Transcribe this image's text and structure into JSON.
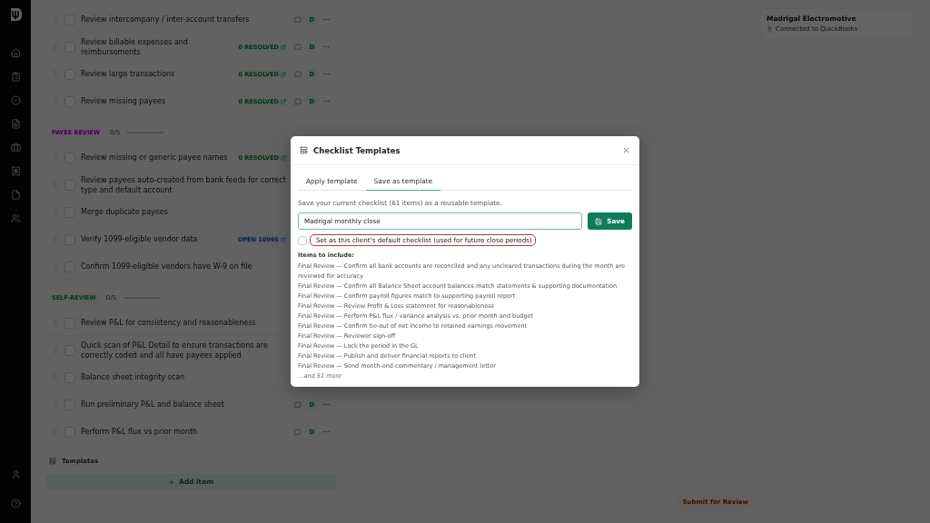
{
  "sections": [
    {
      "items": [
        {
          "title": "Review intercompany / inter-account transfers",
          "checked": false,
          "actions": {
            "avatar": "D"
          }
        },
        {
          "title": "Review billable expenses and reimbursements",
          "checked": false,
          "badge": {
            "text": "0 RESOLVED",
            "kind": "resolved"
          },
          "actions": {
            "avatar": "D"
          }
        },
        {
          "title": "Review large transactions",
          "checked": false,
          "badge": {
            "text": "0 RESOLVED",
            "kind": "resolved"
          },
          "actions": {
            "avatar": "D"
          }
        },
        {
          "title": "Review missing payees",
          "checked": false,
          "badge": {
            "text": "0 RESOLVED",
            "kind": "resolved"
          },
          "actions": {
            "avatar": "D"
          }
        }
      ]
    },
    {
      "header": {
        "label": "PAYEE REVIEW",
        "kind": "payees",
        "count": "0/5"
      },
      "items": [
        {
          "title": "Review missing or generic payee names",
          "checked": false,
          "badge": {
            "text": "0 RESOLVED",
            "kind": "resolved"
          }
        },
        {
          "title": "Review payees auto-created from bank feeds for correct type and default account",
          "checked": false
        },
        {
          "title": "Merge duplicate payees",
          "checked": false
        },
        {
          "title": "Verify 1099-eligible vendor data",
          "checked": false,
          "badge": {
            "text": "OPEN 1099S",
            "kind": "open"
          }
        },
        {
          "title": "Confirm 1099-eligible vendors have W-9 on file",
          "checked": false
        }
      ]
    },
    {
      "header": {
        "label": "SELF-REVIEW",
        "kind": "selfreview",
        "count": "0/5"
      },
      "items": [
        {
          "title": "Review P&L for consistency and reasonableness",
          "checked": false
        },
        {
          "title": "Quick scan of P&L Detail to ensure transactions are correctly coded and all have payees applied",
          "checked": false
        },
        {
          "title": "Balance sheet integrity scan",
          "checked": false
        },
        {
          "title": "Run preliminary P&L and balance sheet",
          "checked": false,
          "actions": {
            "avatar": "D"
          }
        },
        {
          "title": "Perform P&L flux vs prior month",
          "checked": false,
          "actions": {
            "avatar": "D"
          }
        }
      ]
    }
  ],
  "templates_link": "Templates",
  "add_item": "Add item",
  "client_card": {
    "name": "Madrigal Electromotive",
    "status": "Connected to QuickBooks"
  },
  "submit_button": "Submit for Review",
  "modal": {
    "title": "Checklist Templates",
    "tabs": [
      {
        "label": "Apply template",
        "selected": false
      },
      {
        "label": "Save as template",
        "selected": true
      }
    ],
    "description": "Save your current checklist (61 items) as a reusable template.",
    "name_field": {
      "value": "Madrigal monthly close"
    },
    "save_button": "Save",
    "default_checkbox": {
      "label": "Set as this client's default checklist (used for future close periods)",
      "checked": false
    },
    "items_heading": "Items to include:",
    "items": [
      "Final Review — Confirm all bank accounts are reconciled and any uncleared transactions during the month are reviewed for accuracy",
      "Final Review — Confirm all Balance Sheet account balances match statements & supporting documentation",
      "Final Review — Confirm payroll figures match to supporting payroll report",
      "Final Review — Review Profit & Loss statement for reasonableness",
      "Final Review — Perform P&L flux / variance analysis vs. prior month and budget",
      "Final Review — Confirm tie-out of net income to retained earnings movement",
      "Final Review — Reviewer sign-off",
      "Final Review — Lock the period in the GL",
      "Final Review — Publish and deliver financial reports to client",
      "Final Review — Send month-end commentary / management letter"
    ],
    "more": "…and 51 more"
  }
}
